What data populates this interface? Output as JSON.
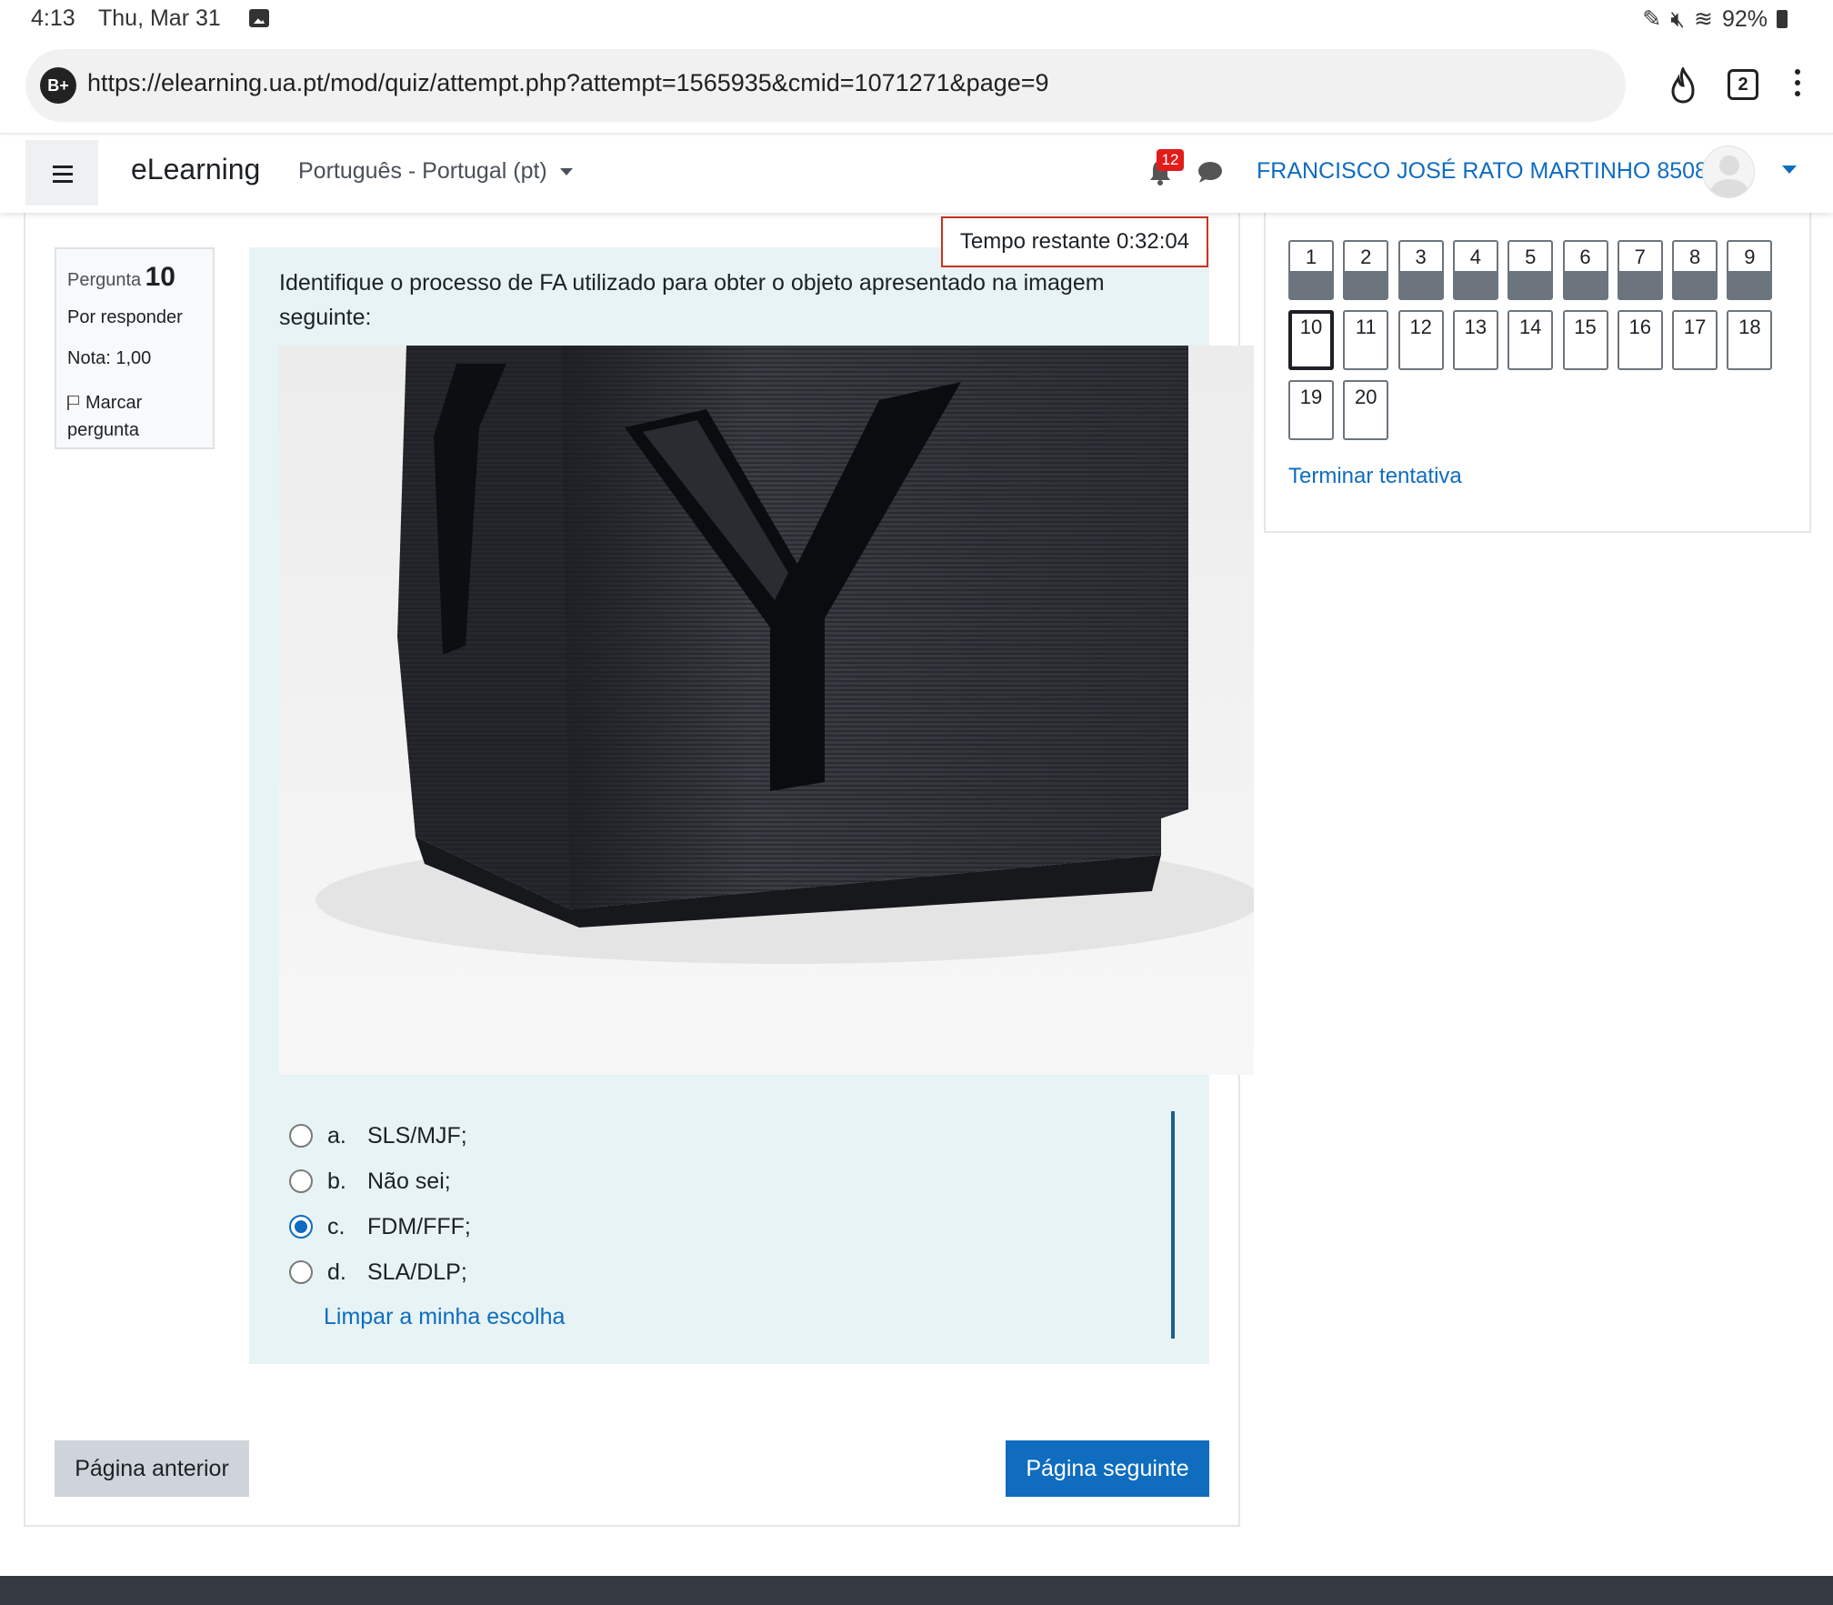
{
  "status_bar": {
    "time": "4:13",
    "date": "Thu, Mar 31",
    "battery": "92%"
  },
  "browser": {
    "site_badge": "B+",
    "url": "https://elearning.ua.pt/mod/quiz/attempt.php?attempt=1565935&cmid=1071271&page=9",
    "tab_count": "2"
  },
  "navbar": {
    "brand": "eLearning",
    "language": "Português - Portugal (pt)",
    "notification_count": "12",
    "user_name": "FRANCISCO JOSÉ RATO MARTINHO 85088"
  },
  "question_info": {
    "label": "Pergunta",
    "number": "10",
    "state": "Por responder",
    "grade": "Nota: 1,00",
    "flag_label": "Marcar pergunta"
  },
  "timer": "Tempo restante 0:32:04",
  "question": {
    "text": "Identifique o processo de FA utilizado para obter o objeto apresentado na imagem seguinte:",
    "answers": [
      {
        "letter": "a.",
        "text": "SLS/MJF;",
        "selected": false
      },
      {
        "letter": "b.",
        "text": "Não sei;",
        "selected": false
      },
      {
        "letter": "c.",
        "text": "FDM/FFF;",
        "selected": true
      },
      {
        "letter": "d.",
        "text": "SLA/DLP;",
        "selected": false
      }
    ],
    "clear_choice": "Limpar a minha escolha"
  },
  "buttons": {
    "previous": "Página anterior",
    "next": "Página seguinte"
  },
  "quiz_nav": {
    "items": [
      "1",
      "2",
      "3",
      "4",
      "5",
      "6",
      "7",
      "8",
      "9",
      "10",
      "11",
      "12",
      "13",
      "14",
      "15",
      "16",
      "17",
      "18",
      "19",
      "20"
    ],
    "answered_count": 9,
    "current": "10",
    "finish_link": "Terminar tentativa"
  },
  "colors": {
    "link": "#0f6cbf",
    "question_bg": "#e7f3f5",
    "timer_border": "#ca3120",
    "footer": "#343a40"
  }
}
